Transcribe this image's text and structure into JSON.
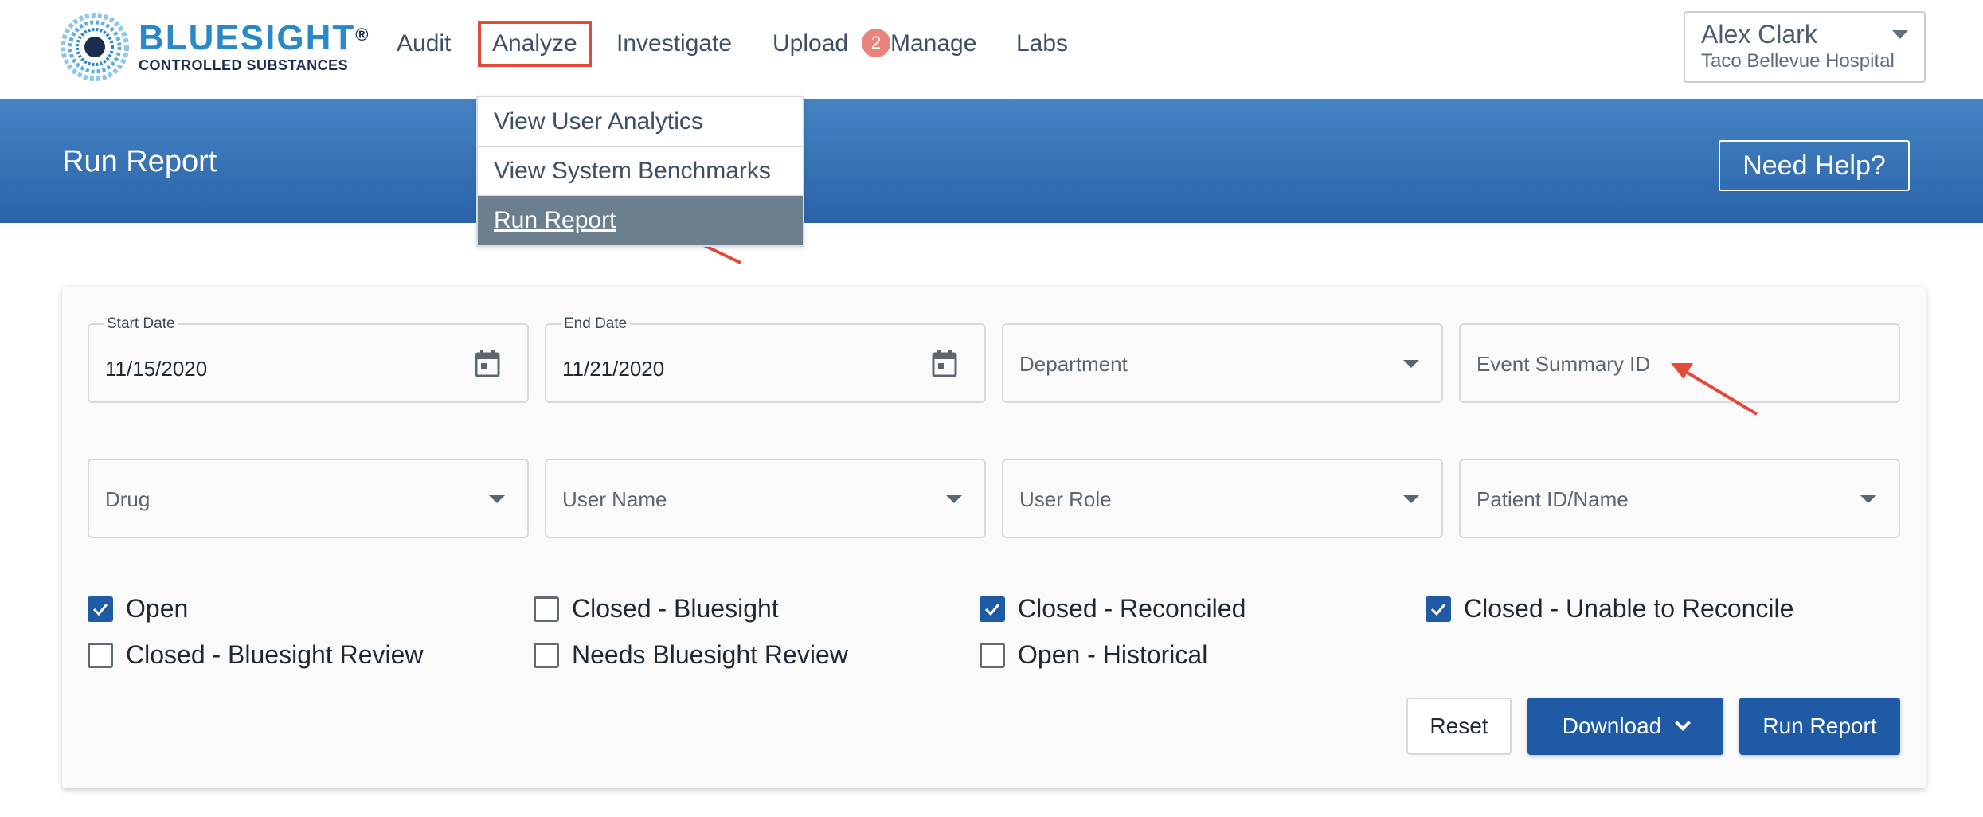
{
  "brand": {
    "name": "BLUESIGHT",
    "registered": "®",
    "tagline": "CONTROLLED SUBSTANCES"
  },
  "nav": {
    "items": [
      {
        "label": "Audit"
      },
      {
        "label": "Analyze"
      },
      {
        "label": "Investigate"
      },
      {
        "label": "Upload"
      },
      {
        "label": "Manage"
      },
      {
        "label": "Labs"
      }
    ],
    "upload_badge": "2"
  },
  "user": {
    "name": "Alex Clark",
    "organization": "Taco Bellevue Hospital"
  },
  "analyze_menu": {
    "items": [
      {
        "label": "View User Analytics"
      },
      {
        "label": "View System Benchmarks"
      },
      {
        "label": "Run Report"
      }
    ],
    "active": "Run Report"
  },
  "header": {
    "title": "Run Report",
    "help_label": "Need Help?"
  },
  "filters": {
    "start_date": {
      "label": "Start Date",
      "value": "11/15/2020"
    },
    "end_date": {
      "label": "End Date",
      "value": "11/21/2020"
    },
    "department": {
      "placeholder": "Department"
    },
    "event_summary_id": {
      "placeholder": "Event Summary ID"
    },
    "drug": {
      "placeholder": "Drug"
    },
    "user_name": {
      "placeholder": "User Name"
    },
    "user_role": {
      "placeholder": "User Role"
    },
    "patient": {
      "placeholder": "Patient ID/Name"
    }
  },
  "statuses": [
    {
      "label": "Open",
      "checked": true
    },
    {
      "label": "Closed - Bluesight",
      "checked": false
    },
    {
      "label": "Closed - Reconciled",
      "checked": true
    },
    {
      "label": "Closed - Unable to Reconcile",
      "checked": true
    },
    {
      "label": "Closed - Bluesight Review",
      "checked": false
    },
    {
      "label": "Needs Bluesight Review",
      "checked": false
    },
    {
      "label": "Open - Historical",
      "checked": false
    }
  ],
  "actions": {
    "reset": "Reset",
    "download": "Download",
    "run": "Run Report"
  },
  "colors": {
    "brand_blue": "#2a87c8",
    "primary_button": "#1f5ba5",
    "annotation_red": "#e34a3a"
  }
}
